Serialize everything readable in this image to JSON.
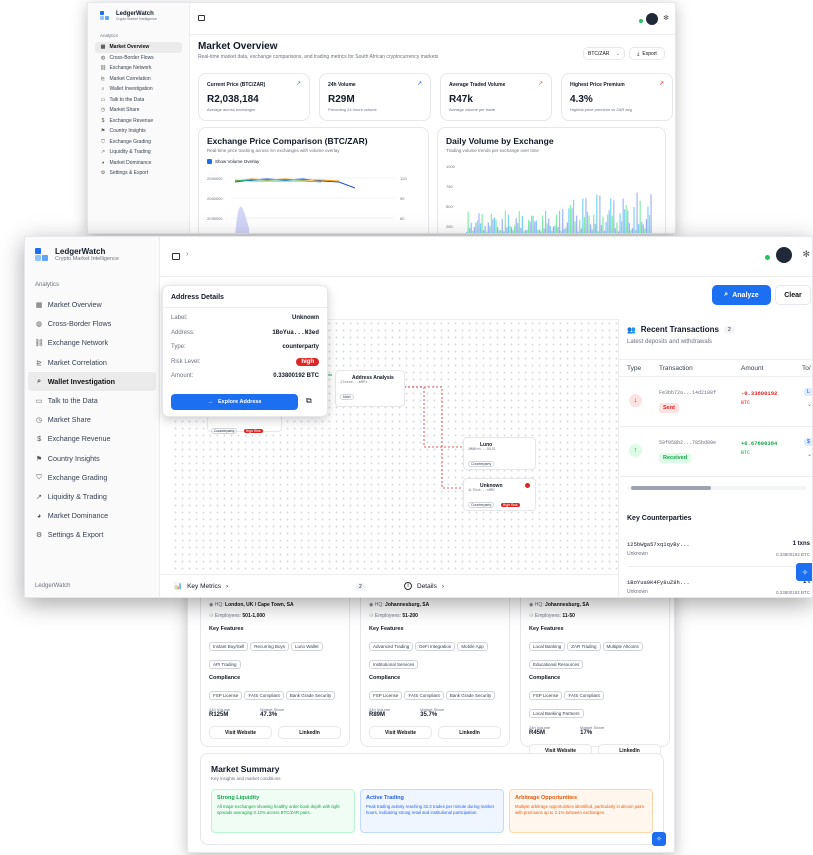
{
  "brand": {
    "name": "LedgerWatch",
    "tagline": "Crypto Market Intelligence",
    "footer": "LedgerWatch"
  },
  "nav": {
    "section": "Analytics",
    "items": [
      {
        "label": "Market Overview",
        "icon": "dashboard-icon"
      },
      {
        "label": "Cross-Border Flows",
        "icon": "globe-icon"
      },
      {
        "label": "Exchange Network",
        "icon": "network-icon"
      },
      {
        "label": "Market Correlation",
        "icon": "chart-icon"
      },
      {
        "label": "Wallet Investigation",
        "icon": "search-icon"
      },
      {
        "label": "Talk to the Data",
        "icon": "chat-icon"
      },
      {
        "label": "Market Share",
        "icon": "clock-icon"
      },
      {
        "label": "Exchange Revenue",
        "icon": "dollar-icon"
      },
      {
        "label": "Country Insights",
        "icon": "flag-icon"
      },
      {
        "label": "Exchange Grading",
        "icon": "shield-icon"
      },
      {
        "label": "Liquidity & Trading",
        "icon": "trend-icon"
      },
      {
        "label": "Market Dominance",
        "icon": "pie-icon"
      },
      {
        "label": "Settings & Export",
        "icon": "gear-icon"
      }
    ]
  },
  "overview": {
    "title": "Market Overview",
    "subtitle": "Real-time market data, exchange comparisons, and trading metrics for South African cryptocurrency markets",
    "pair": "BTC/ZAR",
    "export_label": "Export",
    "stats": [
      {
        "label": "Current Price (BTC/ZAR)",
        "value": "R2,038,184",
        "sub": "Average across exchanges"
      },
      {
        "label": "24h Volume",
        "value": "R29M",
        "sub": "Preceding 24 hours volume"
      },
      {
        "label": "Average Traded Volume",
        "value": "R47k",
        "sub": "Average volume per trade"
      },
      {
        "label": "Highest Price Premium",
        "value": "4.3%",
        "sub": "Highest price premium vs ZAR avg"
      }
    ],
    "price_chart": {
      "title": "Exchange Price Comparison (BTC/ZAR)",
      "subtitle": "Real-time price tracking across SA exchanges with volume overlay",
      "toggle": "Show Volume Overlay",
      "y_ticks": [
        "2045000",
        "2040000",
        "2035000"
      ],
      "y2_ticks": [
        "120",
        "90",
        "60"
      ]
    },
    "volume_chart": {
      "title": "Daily Volume by Exchange",
      "subtitle": "Trading volume trends per exchange over time",
      "y_ticks": [
        "1000",
        "750",
        "500",
        "250"
      ]
    }
  },
  "investigation": {
    "analyze_label": "Analyze",
    "clear_label": "Clear",
    "address_panel": {
      "title": "Address Details",
      "rows": [
        {
          "key": "Label:",
          "value": "Unknown"
        },
        {
          "key": "Address:",
          "value": "1BoYua...N3ed"
        },
        {
          "key": "Type:",
          "value": "counterparty"
        },
        {
          "key": "Risk Level:",
          "value": "high"
        },
        {
          "key": "Amount:",
          "value": "0.33800192 BTC"
        }
      ],
      "explore_label": "Explore Address"
    },
    "graph": {
      "nodes": [
        {
          "title": "Address Analysis",
          "sub": "17xoze...mRPs",
          "tag": "Main"
        },
        {
          "title": "Counterparty",
          "tag": "High Risk"
        },
        {
          "title": "Luno",
          "sub": "1MNEnh...9XJS",
          "tag": "Counterparty"
        },
        {
          "title": "Unknown",
          "sub": "1L7Uuk...sMRC",
          "tag": "Counterparty",
          "risk": "High Risk"
        }
      ]
    },
    "transactions": {
      "title": "Recent Transactions",
      "count": "2",
      "subtitle": "Latest deposits and withdrawals",
      "columns": [
        "Type",
        "Transaction",
        "Amount",
        "To/"
      ],
      "rows": [
        {
          "hash": "Fe3bb72a...14d2108f",
          "status": "Sent",
          "amount": "-0.33800192",
          "unit": "BTC",
          "to": "L"
        },
        {
          "hash": "59f958b2...785bd89e",
          "status": "Received",
          "amount": "+0.67600384",
          "unit": "BTC",
          "to": "$"
        }
      ]
    },
    "counterparties": {
      "title": "Key Counterparties",
      "rows": [
        {
          "addr": "125bWga57xq1qyBy...",
          "label": "Unknown",
          "txns": "1 txns",
          "amount": "0.33800192 BTC"
        },
        {
          "addr": "1BoYua9K4Fy8uZ8h...",
          "label": "Unknown",
          "txns": "1 t",
          "amount": "0.33800192 BTC"
        }
      ]
    },
    "bottom": {
      "metrics_label": "Key Metrics",
      "metrics_count": "2",
      "details_label": "Details"
    }
  },
  "exchanges": [
    {
      "founded": "2013",
      "hq": "London, UK / Cape Town, SA",
      "employees": "501-1,000",
      "features": [
        "Instant Buy/Sell",
        "Recurring Buys",
        "Luno Wallet",
        "API Trading"
      ],
      "compliance": [
        "FSP License",
        "FAIS Compliant",
        "Bank Grade Security"
      ],
      "volume": "R125M",
      "share": "47.3%"
    },
    {
      "founded": "2018",
      "hq": "Johannesburg, SA",
      "employees": "51-200",
      "features": [
        "Advanced Trading",
        "DeFi Integration",
        "Mobile App",
        "Institutional Services"
      ],
      "compliance": [
        "FSP License",
        "FAIS Compliant",
        "Bank Grade Security"
      ],
      "volume": "R89M",
      "share": "35.7%"
    },
    {
      "founded": "2012",
      "hq": "Johannesburg, SA",
      "employees": "11-50",
      "features": [
        "Local Banking",
        "ZAR Trading",
        "Multiple Altcoins",
        "Educational Resources"
      ],
      "compliance": [
        "FSP License",
        "FAIS Compliant",
        "Local Banking Partners"
      ],
      "volume": "R45M",
      "share": "17%"
    }
  ],
  "exchange_labels": {
    "founded": "Founded:",
    "hq": "HQ:",
    "employees": "Employees:",
    "features": "Key Features",
    "compliance": "Compliance",
    "volume": "24h Volume",
    "share": "Market Share",
    "website": "Visit Website",
    "linkedin": "LinkedIn"
  },
  "summary": {
    "title": "Market Summary",
    "subtitle": "Key insights and market conditions",
    "items": [
      {
        "title": "Strong Liquidity",
        "text": "All major exchanges showing healthy order book depth with tight spreads averaging 0.12% across BTC/ZAR pairs.",
        "color": "#16a34a"
      },
      {
        "title": "Active Trading",
        "text": "Peak trading activity reaching 32.3 trades per minute during market hours, indicating strong retail and institutional participation.",
        "color": "#2563eb"
      },
      {
        "title": "Arbitrage Opportunities",
        "text": "Multiple arbitrage opportunities identified, particularly in altcoin pairs with premiums up to 2.1% between exchanges.",
        "color": "#ea580c"
      }
    ]
  },
  "colors": {
    "accent": "#1d6ff2",
    "danger": "#dc2626",
    "success": "#16a34a"
  }
}
